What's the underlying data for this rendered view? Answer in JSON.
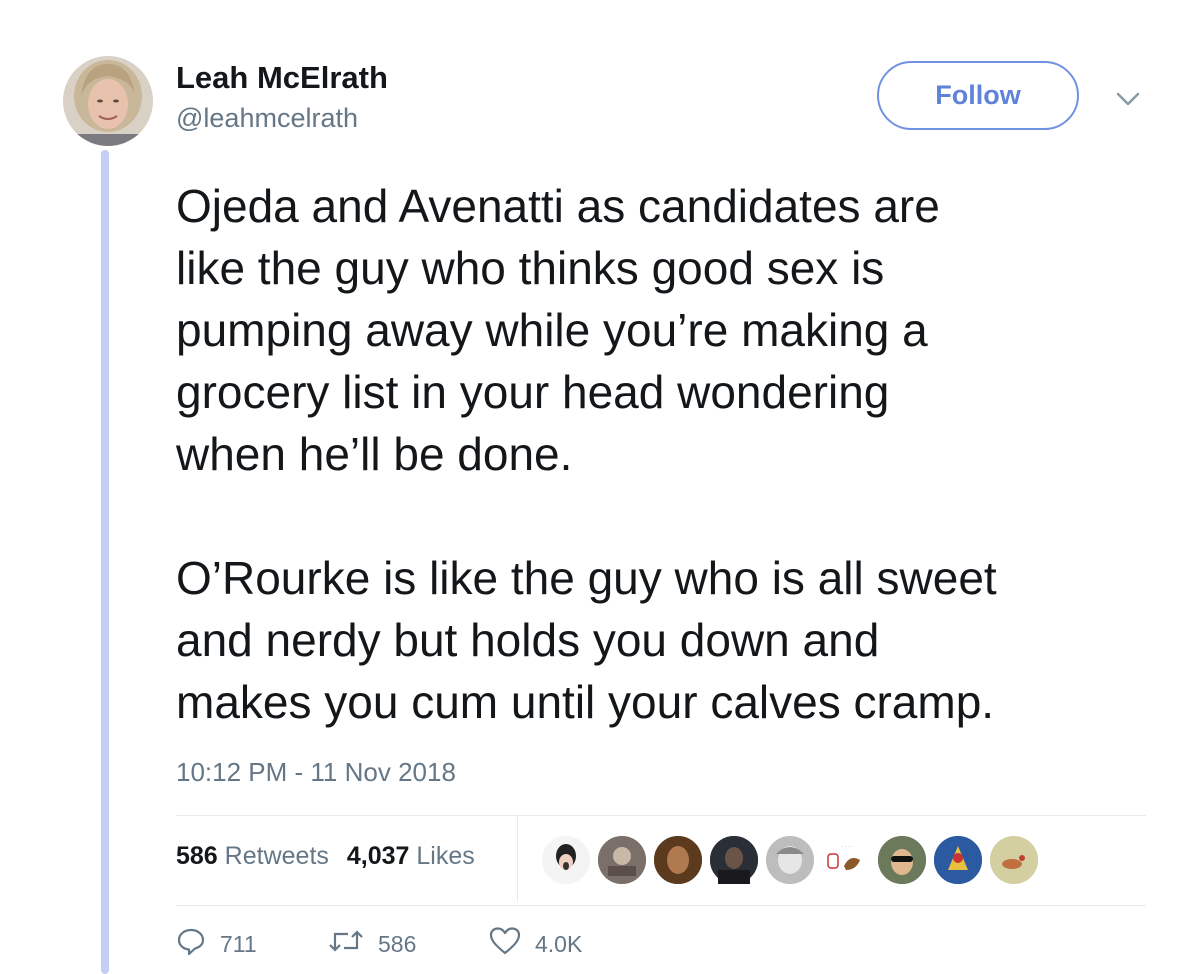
{
  "user": {
    "name": "Leah McElrath",
    "handle": "@leahmcelrath"
  },
  "follow_label": "Follow",
  "tweet": {
    "paragraphs": [
      "Ojeda and Avenatti as candidates are\nlike the guy who thinks good sex is\npumping away while you’re making a\ngrocery list in your head wondering\nwhen he’ll be done.",
      "O’Rourke is like the guy who is all sweet\nand nerdy but holds you down and\nmakes you cum until your calves cramp."
    ],
    "timestamp": "10:12 PM - 11 Nov 2018"
  },
  "stats": {
    "retweets_count": "586",
    "retweets_label": "Retweets",
    "likes_count": "4,037",
    "likes_label": "Likes"
  },
  "actions": {
    "replies": "711",
    "retweets": "586",
    "likes": "4.0K"
  },
  "colors": {
    "accent": "#5f83d8",
    "thread_line": "#c4cff5",
    "secondary_text": "#657786"
  }
}
